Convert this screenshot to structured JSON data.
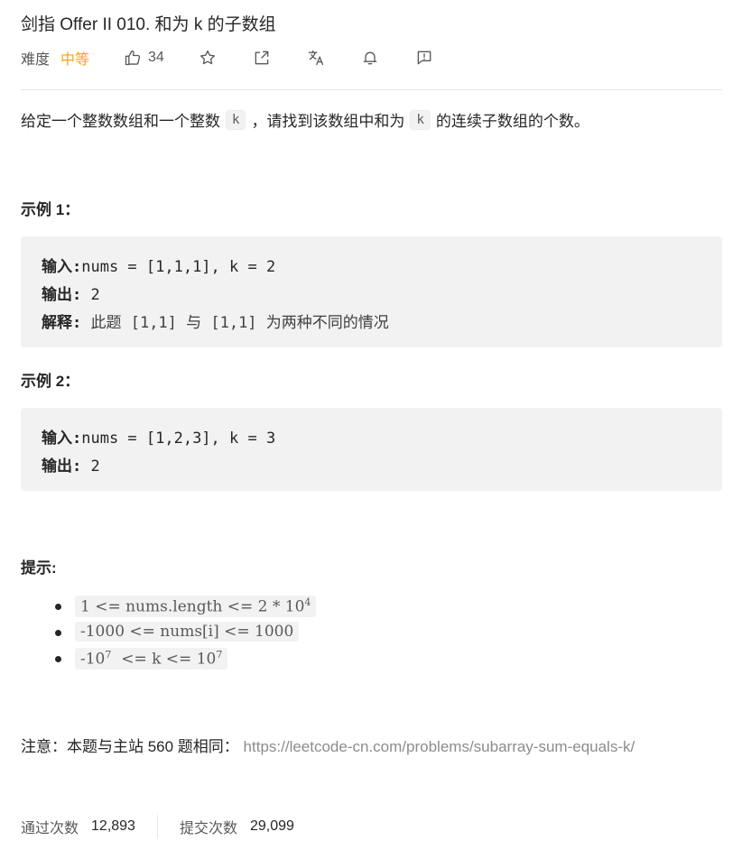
{
  "problem": {
    "title": "剑指 Offer II 010. 和为 k 的子数组",
    "difficulty_label": "难度",
    "difficulty": "中等",
    "likes": "34"
  },
  "toolbar": {
    "like_icon": "thumbs-up-icon",
    "star_icon": "star-icon",
    "share_icon": "share-icon",
    "translate_icon": "translate-icon",
    "bell_icon": "bell-icon",
    "feedback_icon": "feedback-icon"
  },
  "description": {
    "part1": "给定一个整数数组和一个整数",
    "code1": "k",
    "part2": "，请找到该数组中和为",
    "code2": "k",
    "part3": "的连续子数组的个数。"
  },
  "examples": [
    {
      "heading": "示例 1：",
      "input_label": "输入:",
      "input_value": "nums = [1,1,1], k = 2",
      "output_label": "输出:",
      "output_value": " 2",
      "explain_label": "解释:",
      "explain_value": " 此题 [1,1] 与 [1,1] 为两种不同的情况"
    },
    {
      "heading": "示例 2：",
      "input_label": "输入:",
      "input_value": "nums = [1,2,3], k = 3",
      "output_label": "输出:",
      "output_value": " 2"
    }
  ],
  "hints": {
    "heading": "提示:",
    "items": [
      {
        "text": "1 <= nums.length <= 2 * 10",
        "sup": "4",
        "after": ""
      },
      {
        "text": "-1000 <= nums[i] <= 1000",
        "sup": "",
        "after": ""
      },
      {
        "text": "-10",
        "sup": "7",
        "after": "  <= k <= 10",
        "sup2": "7"
      }
    ]
  },
  "note": {
    "prefix": "注意：本题与主站 560 题相同：",
    "link": "https://leetcode-cn.com/problems/subarray-sum-equals-k/"
  },
  "stats": {
    "accepted_label": "通过次数",
    "accepted": "12,893",
    "submissions_label": "提交次数",
    "submissions": "29,099"
  }
}
